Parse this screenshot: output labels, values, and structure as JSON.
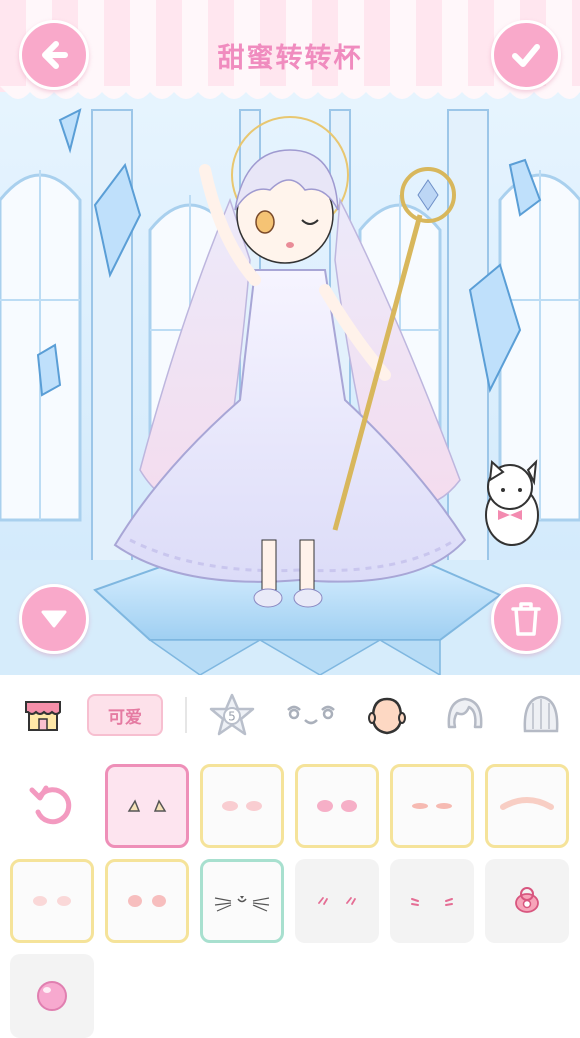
{
  "header": {
    "title": "甜蜜转转杯",
    "back_icon": "arrow-left-icon",
    "confirm_icon": "checkmark-icon"
  },
  "scene": {
    "description_icons": [
      "crystal-icon",
      "character-icon",
      "staff-icon",
      "cat-icon"
    ]
  },
  "tabs": {
    "shop_icon": "shop-icon",
    "cute_label": "可爱",
    "sticker_badge": "5",
    "items": [
      "shop",
      "cute",
      "stickers",
      "face",
      "skin",
      "hair",
      "back-hair"
    ]
  },
  "grid": {
    "reset_icon": "reset-icon",
    "items": [
      {
        "name": "blush-pointed",
        "style": "selected"
      },
      {
        "name": "blush-soft-pink",
        "style": "yellow"
      },
      {
        "name": "blush-rosy",
        "style": "yellow"
      },
      {
        "name": "blush-lines",
        "style": "yellow"
      },
      {
        "name": "blush-wide",
        "style": "yellow"
      },
      {
        "name": "blush-light",
        "style": "yellow"
      },
      {
        "name": "blush-round",
        "style": "yellow"
      },
      {
        "name": "whiskers",
        "style": "mint"
      },
      {
        "name": "blush-marks-small",
        "style": "plain"
      },
      {
        "name": "blush-marks-lines",
        "style": "plain"
      },
      {
        "name": "pacifier",
        "style": "plain"
      },
      {
        "name": "pink-bubble",
        "style": "plain"
      }
    ]
  },
  "colors": {
    "accent_pink": "#f9a9ca",
    "title_pink": "#f08cbf",
    "selected_border": "#ee8fb8",
    "yellow_border": "#f5e39a",
    "mint_border": "#a8e0cf"
  }
}
